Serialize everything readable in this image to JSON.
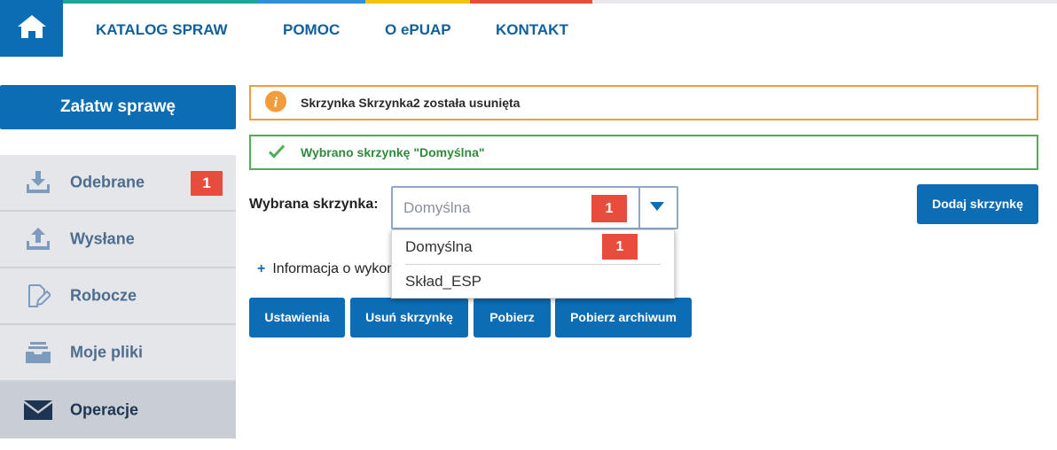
{
  "colors": {
    "primary": "#0c6db4",
    "badge": "#e74c3c",
    "warn_border": "#f39c3c",
    "success": "#4caf50",
    "stripe": [
      "#1aa699",
      "#2d8fd5",
      "#f1c40f",
      "#e74c3c",
      "#e6e8ee"
    ]
  },
  "header": {
    "home_icon": "home-icon",
    "nav": [
      "KATALOG SPRAW",
      "POMOC",
      "O ePUAP",
      "KONTAKT"
    ]
  },
  "sidebar": {
    "cta": "Załatw sprawę",
    "items": [
      {
        "label": "Odebrane",
        "icon": "inbox-download-icon",
        "badge": "1"
      },
      {
        "label": "Wysłane",
        "icon": "outbox-upload-icon"
      },
      {
        "label": "Robocze",
        "icon": "draft-edit-icon"
      },
      {
        "label": "Moje pliki",
        "icon": "files-tray-icon"
      },
      {
        "label": "Operacje",
        "icon": "envelope-icon",
        "active": true
      }
    ]
  },
  "alerts": {
    "warning": {
      "icon": "info-icon",
      "text": "Skrzynka Skrzynka2 została usunięta"
    },
    "success": {
      "icon": "check-icon",
      "text": "Wybrano skrzynkę \"Domyślna\""
    }
  },
  "mailbox": {
    "label": "Wybrana skrzynka:",
    "selected": "Domyślna",
    "badge": "1",
    "options": [
      {
        "label": "Domyślna",
        "badge": "1"
      },
      {
        "label": "Skład_ESP"
      }
    ]
  },
  "add_button": "Dodaj skrzynkę",
  "info": {
    "plus": "+",
    "text": "Informacja o wykon"
  },
  "actions": [
    "Ustawienia",
    "Usuń skrzynkę",
    "Pobierz",
    "Pobierz archiwum"
  ]
}
